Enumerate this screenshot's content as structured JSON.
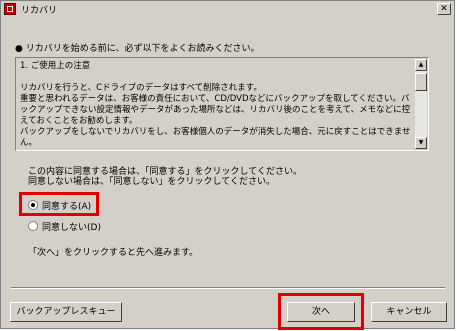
{
  "window": {
    "title": "リカバリ"
  },
  "notice": "● リカバリを始める前に、必ず以下をよくお読みください。",
  "textbox": {
    "content": "1. ご使用上の注意\n\nリカバリを行うと、Cドライブのデータはすべて削除されます。\n重要と思われるデータは、お客様の責任において、CD/DVDなどにバックアップを取してください。バックアップできない設定情報やデータがあった場所などは、リカバリ後のことを考えて、メモなどに控えておくことをお勧めします。\nバックアップをしないでリカバリをし、お客様個人のデータが消失した場合、元に戻すことはできません。"
  },
  "instructions": "この内容に同意する場合は、「同意する」をクリックしてください。\n同意しない場合は、「同意しない」をクリックしてください。",
  "radios": {
    "agree": {
      "label": "同意する(A)",
      "checked": true
    },
    "disagree": {
      "label": "同意しない(D)",
      "checked": false
    }
  },
  "next_note": "「次へ」をクリックすると先へ進みます。",
  "buttons": {
    "backup_rescue": "バックアップレスキュー",
    "next": "次へ",
    "cancel": "キャンセル"
  },
  "colors": {
    "highlight_red": "#e00000",
    "face": "#d4d0c8"
  }
}
